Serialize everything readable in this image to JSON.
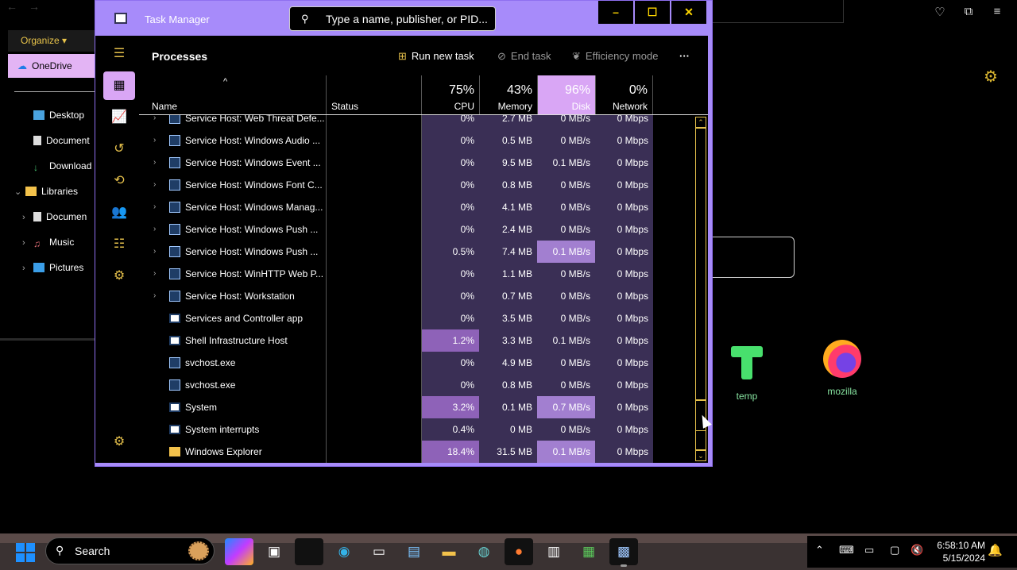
{
  "explorer": {
    "organize_label": "Organize",
    "onedrive_label": "OneDrive",
    "items": [
      {
        "label": "Desktop",
        "icon": "desktop-icon"
      },
      {
        "label": "Document",
        "icon": "documents-icon"
      },
      {
        "label": "Download",
        "icon": "downloads-icon"
      },
      {
        "label": "Libraries",
        "icon": "folder-icon"
      },
      {
        "label": "Documen",
        "icon": "documents-icon"
      },
      {
        "label": "Music",
        "icon": "music-icon"
      },
      {
        "label": "Pictures",
        "icon": "pictures-icon"
      }
    ]
  },
  "desktop_icons": [
    {
      "label": "temp"
    },
    {
      "label": "mozilla"
    }
  ],
  "task_manager": {
    "app_name": "Task Manager",
    "search_placeholder": "Type a name, publisher, or PID...",
    "window_buttons": {
      "minimize": "–",
      "maximize": "☐",
      "close": "✕"
    },
    "page_title": "Processes",
    "toolbar": {
      "run_new_task": "Run new task",
      "end_task": "End task",
      "efficiency_mode": "Efficiency mode",
      "more": "···"
    },
    "columns": {
      "name": "Name",
      "status": "Status",
      "cpu": {
        "pct": "75%",
        "label": "CPU"
      },
      "memory": {
        "pct": "43%",
        "label": "Memory"
      },
      "disk": {
        "pct": "96%",
        "label": "Disk"
      },
      "network": {
        "pct": "0%",
        "label": "Network"
      }
    },
    "processes": [
      {
        "name": "Service Host: Web Threat Defe...",
        "expandable": true,
        "icon": "gear-box",
        "cpu": "0%",
        "memory": "2.7 MB",
        "disk": "0 MB/s",
        "network": "0 Mbps"
      },
      {
        "name": "Service Host: Windows Audio ...",
        "expandable": true,
        "icon": "gear-box",
        "cpu": "0%",
        "memory": "0.5 MB",
        "disk": "0 MB/s",
        "network": "0 Mbps"
      },
      {
        "name": "Service Host: Windows Event ...",
        "expandable": true,
        "icon": "gear-box",
        "cpu": "0%",
        "memory": "9.5 MB",
        "disk": "0.1 MB/s",
        "network": "0 Mbps"
      },
      {
        "name": "Service Host: Windows Font C...",
        "expandable": true,
        "icon": "gear-box",
        "cpu": "0%",
        "memory": "0.8 MB",
        "disk": "0 MB/s",
        "network": "0 Mbps"
      },
      {
        "name": "Service Host: Windows Manag...",
        "expandable": true,
        "icon": "gear-box",
        "cpu": "0%",
        "memory": "4.1 MB",
        "disk": "0 MB/s",
        "network": "0 Mbps"
      },
      {
        "name": "Service Host: Windows Push ...",
        "expandable": true,
        "icon": "gear-box",
        "cpu": "0%",
        "memory": "2.4 MB",
        "disk": "0 MB/s",
        "network": "0 Mbps"
      },
      {
        "name": "Service Host: Windows Push ...",
        "expandable": true,
        "icon": "gear-box",
        "cpu": "0.5%",
        "memory": "7.4 MB",
        "disk": "0.1 MB/s",
        "network": "0 Mbps",
        "disk_hi": true
      },
      {
        "name": "Service Host: WinHTTP Web P...",
        "expandable": true,
        "icon": "gear-box",
        "cpu": "0%",
        "memory": "1.1 MB",
        "disk": "0 MB/s",
        "network": "0 Mbps"
      },
      {
        "name": "Service Host: Workstation",
        "expandable": true,
        "icon": "gear-box",
        "cpu": "0%",
        "memory": "0.7 MB",
        "disk": "0 MB/s",
        "network": "0 Mbps"
      },
      {
        "name": "Services and Controller app",
        "expandable": false,
        "icon": "window",
        "cpu": "0%",
        "memory": "3.5 MB",
        "disk": "0 MB/s",
        "network": "0 Mbps"
      },
      {
        "name": "Shell Infrastructure Host",
        "expandable": false,
        "icon": "window",
        "cpu": "1.2%",
        "memory": "3.3 MB",
        "disk": "0.1 MB/s",
        "network": "0 Mbps",
        "cpu_hi": true
      },
      {
        "name": "svchost.exe",
        "expandable": false,
        "icon": "gear-box",
        "cpu": "0%",
        "memory": "4.9 MB",
        "disk": "0 MB/s",
        "network": "0 Mbps"
      },
      {
        "name": "svchost.exe",
        "expandable": false,
        "icon": "gear-box",
        "cpu": "0%",
        "memory": "0.8 MB",
        "disk": "0 MB/s",
        "network": "0 Mbps"
      },
      {
        "name": "System",
        "expandable": false,
        "icon": "window",
        "cpu": "3.2%",
        "memory": "0.1 MB",
        "disk": "0.7 MB/s",
        "network": "0 Mbps",
        "cpu_hi": true,
        "disk_hi": true
      },
      {
        "name": "System interrupts",
        "expandable": false,
        "icon": "window",
        "cpu": "0.4%",
        "memory": "0 MB",
        "disk": "0 MB/s",
        "network": "0 Mbps"
      },
      {
        "name": "Windows Explorer",
        "expandable": false,
        "icon": "folder",
        "cpu": "18.4%",
        "memory": "31.5 MB",
        "disk": "0.1 MB/s",
        "network": "0 Mbps",
        "cpu_hi": true,
        "disk_hi": true
      }
    ]
  },
  "taskbar": {
    "search_label": "Search",
    "clock_time": "6:58:10 AM",
    "clock_date": "5/15/2024"
  },
  "colors": {
    "accent": "#a78bfa",
    "highlight": "#d9a6f5",
    "icon_yellow": "#e5c04b"
  }
}
